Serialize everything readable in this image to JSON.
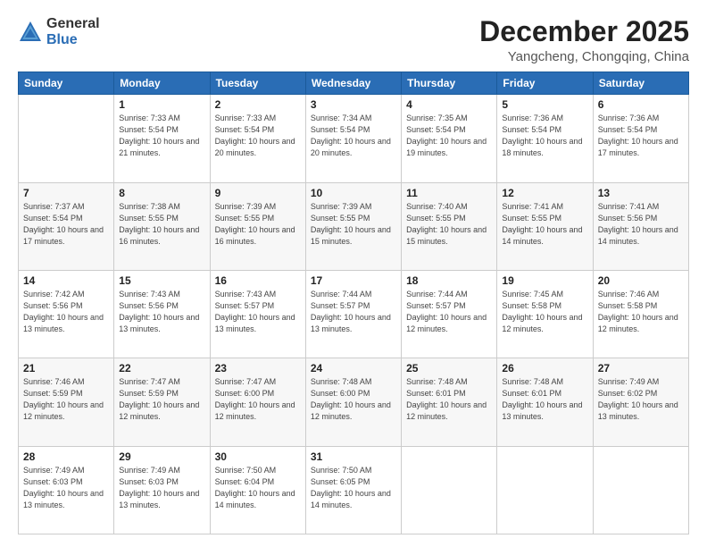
{
  "logo": {
    "general": "General",
    "blue": "Blue"
  },
  "title": {
    "month": "December 2025",
    "location": "Yangcheng, Chongqing, China"
  },
  "weekdays": [
    "Sunday",
    "Monday",
    "Tuesday",
    "Wednesday",
    "Thursday",
    "Friday",
    "Saturday"
  ],
  "weeks": [
    [
      {
        "day": "",
        "sunrise": "",
        "sunset": "",
        "daylight": ""
      },
      {
        "day": "1",
        "sunrise": "Sunrise: 7:33 AM",
        "sunset": "Sunset: 5:54 PM",
        "daylight": "Daylight: 10 hours and 21 minutes."
      },
      {
        "day": "2",
        "sunrise": "Sunrise: 7:33 AM",
        "sunset": "Sunset: 5:54 PM",
        "daylight": "Daylight: 10 hours and 20 minutes."
      },
      {
        "day": "3",
        "sunrise": "Sunrise: 7:34 AM",
        "sunset": "Sunset: 5:54 PM",
        "daylight": "Daylight: 10 hours and 20 minutes."
      },
      {
        "day": "4",
        "sunrise": "Sunrise: 7:35 AM",
        "sunset": "Sunset: 5:54 PM",
        "daylight": "Daylight: 10 hours and 19 minutes."
      },
      {
        "day": "5",
        "sunrise": "Sunrise: 7:36 AM",
        "sunset": "Sunset: 5:54 PM",
        "daylight": "Daylight: 10 hours and 18 minutes."
      },
      {
        "day": "6",
        "sunrise": "Sunrise: 7:36 AM",
        "sunset": "Sunset: 5:54 PM",
        "daylight": "Daylight: 10 hours and 17 minutes."
      }
    ],
    [
      {
        "day": "7",
        "sunrise": "Sunrise: 7:37 AM",
        "sunset": "Sunset: 5:54 PM",
        "daylight": "Daylight: 10 hours and 17 minutes."
      },
      {
        "day": "8",
        "sunrise": "Sunrise: 7:38 AM",
        "sunset": "Sunset: 5:55 PM",
        "daylight": "Daylight: 10 hours and 16 minutes."
      },
      {
        "day": "9",
        "sunrise": "Sunrise: 7:39 AM",
        "sunset": "Sunset: 5:55 PM",
        "daylight": "Daylight: 10 hours and 16 minutes."
      },
      {
        "day": "10",
        "sunrise": "Sunrise: 7:39 AM",
        "sunset": "Sunset: 5:55 PM",
        "daylight": "Daylight: 10 hours and 15 minutes."
      },
      {
        "day": "11",
        "sunrise": "Sunrise: 7:40 AM",
        "sunset": "Sunset: 5:55 PM",
        "daylight": "Daylight: 10 hours and 15 minutes."
      },
      {
        "day": "12",
        "sunrise": "Sunrise: 7:41 AM",
        "sunset": "Sunset: 5:55 PM",
        "daylight": "Daylight: 10 hours and 14 minutes."
      },
      {
        "day": "13",
        "sunrise": "Sunrise: 7:41 AM",
        "sunset": "Sunset: 5:56 PM",
        "daylight": "Daylight: 10 hours and 14 minutes."
      }
    ],
    [
      {
        "day": "14",
        "sunrise": "Sunrise: 7:42 AM",
        "sunset": "Sunset: 5:56 PM",
        "daylight": "Daylight: 10 hours and 13 minutes."
      },
      {
        "day": "15",
        "sunrise": "Sunrise: 7:43 AM",
        "sunset": "Sunset: 5:56 PM",
        "daylight": "Daylight: 10 hours and 13 minutes."
      },
      {
        "day": "16",
        "sunrise": "Sunrise: 7:43 AM",
        "sunset": "Sunset: 5:57 PM",
        "daylight": "Daylight: 10 hours and 13 minutes."
      },
      {
        "day": "17",
        "sunrise": "Sunrise: 7:44 AM",
        "sunset": "Sunset: 5:57 PM",
        "daylight": "Daylight: 10 hours and 13 minutes."
      },
      {
        "day": "18",
        "sunrise": "Sunrise: 7:44 AM",
        "sunset": "Sunset: 5:57 PM",
        "daylight": "Daylight: 10 hours and 12 minutes."
      },
      {
        "day": "19",
        "sunrise": "Sunrise: 7:45 AM",
        "sunset": "Sunset: 5:58 PM",
        "daylight": "Daylight: 10 hours and 12 minutes."
      },
      {
        "day": "20",
        "sunrise": "Sunrise: 7:46 AM",
        "sunset": "Sunset: 5:58 PM",
        "daylight": "Daylight: 10 hours and 12 minutes."
      }
    ],
    [
      {
        "day": "21",
        "sunrise": "Sunrise: 7:46 AM",
        "sunset": "Sunset: 5:59 PM",
        "daylight": "Daylight: 10 hours and 12 minutes."
      },
      {
        "day": "22",
        "sunrise": "Sunrise: 7:47 AM",
        "sunset": "Sunset: 5:59 PM",
        "daylight": "Daylight: 10 hours and 12 minutes."
      },
      {
        "day": "23",
        "sunrise": "Sunrise: 7:47 AM",
        "sunset": "Sunset: 6:00 PM",
        "daylight": "Daylight: 10 hours and 12 minutes."
      },
      {
        "day": "24",
        "sunrise": "Sunrise: 7:48 AM",
        "sunset": "Sunset: 6:00 PM",
        "daylight": "Daylight: 10 hours and 12 minutes."
      },
      {
        "day": "25",
        "sunrise": "Sunrise: 7:48 AM",
        "sunset": "Sunset: 6:01 PM",
        "daylight": "Daylight: 10 hours and 12 minutes."
      },
      {
        "day": "26",
        "sunrise": "Sunrise: 7:48 AM",
        "sunset": "Sunset: 6:01 PM",
        "daylight": "Daylight: 10 hours and 13 minutes."
      },
      {
        "day": "27",
        "sunrise": "Sunrise: 7:49 AM",
        "sunset": "Sunset: 6:02 PM",
        "daylight": "Daylight: 10 hours and 13 minutes."
      }
    ],
    [
      {
        "day": "28",
        "sunrise": "Sunrise: 7:49 AM",
        "sunset": "Sunset: 6:03 PM",
        "daylight": "Daylight: 10 hours and 13 minutes."
      },
      {
        "day": "29",
        "sunrise": "Sunrise: 7:49 AM",
        "sunset": "Sunset: 6:03 PM",
        "daylight": "Daylight: 10 hours and 13 minutes."
      },
      {
        "day": "30",
        "sunrise": "Sunrise: 7:50 AM",
        "sunset": "Sunset: 6:04 PM",
        "daylight": "Daylight: 10 hours and 14 minutes."
      },
      {
        "day": "31",
        "sunrise": "Sunrise: 7:50 AM",
        "sunset": "Sunset: 6:05 PM",
        "daylight": "Daylight: 10 hours and 14 minutes."
      },
      {
        "day": "",
        "sunrise": "",
        "sunset": "",
        "daylight": ""
      },
      {
        "day": "",
        "sunrise": "",
        "sunset": "",
        "daylight": ""
      },
      {
        "day": "",
        "sunrise": "",
        "sunset": "",
        "daylight": ""
      }
    ]
  ]
}
